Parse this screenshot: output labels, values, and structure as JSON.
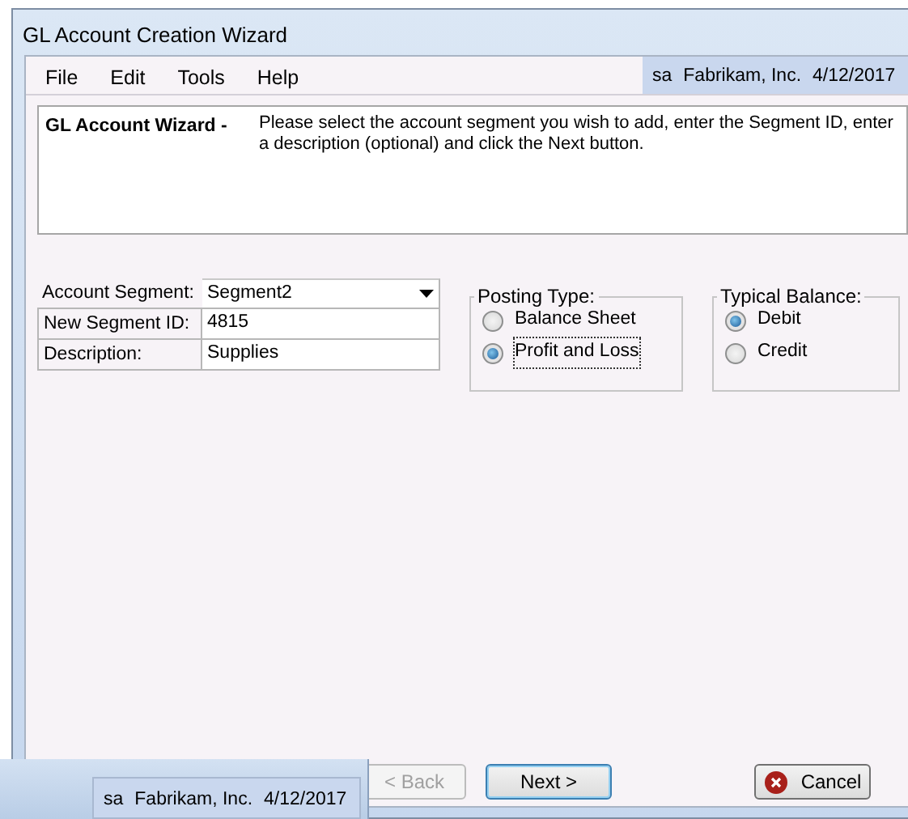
{
  "window": {
    "title": "GL Account Creation Wizard"
  },
  "menu": [
    {
      "label": "File"
    },
    {
      "label": "Edit"
    },
    {
      "label": "Tools"
    },
    {
      "label": "Help"
    }
  ],
  "status": {
    "user": "sa",
    "company": "Fabrikam, Inc.",
    "date": "4/12/2017"
  },
  "instructions": {
    "heading": "GL Account Wizard -",
    "text": "Please select the account segment you wish to add, enter the Segment ID, enter a description (optional) and click the Next button."
  },
  "fields": [
    {
      "kind": "dropdown",
      "label": "Account Segment:",
      "value": "Segment2"
    },
    {
      "kind": "text",
      "label": "New Segment ID:",
      "value": "4815"
    },
    {
      "kind": "text",
      "label": "Description:",
      "value": "Supplies"
    }
  ],
  "posting_type": {
    "title": "Posting Type:",
    "options": [
      {
        "label": "Balance Sheet",
        "selected": false,
        "focused": false
      },
      {
        "label": "Profit and Loss",
        "selected": true,
        "focused": true
      }
    ]
  },
  "typical_balance": {
    "title": "Typical Balance:",
    "options": [
      {
        "label": "Debit",
        "selected": true,
        "focused": false
      },
      {
        "label": "Credit",
        "selected": false,
        "focused": false
      }
    ]
  },
  "buttons": [
    {
      "kind": "plain",
      "label": "< Back",
      "disabled": true,
      "focused": false
    },
    {
      "kind": "plain",
      "label": "Next >",
      "disabled": false,
      "focused": true
    },
    {
      "kind": "cancel",
      "label": "Cancel",
      "disabled": false,
      "focused": false
    }
  ],
  "background_window": {
    "status": {
      "user": "sa",
      "company": "Fabrikam, Inc.",
      "date": "4/12/2017"
    }
  }
}
